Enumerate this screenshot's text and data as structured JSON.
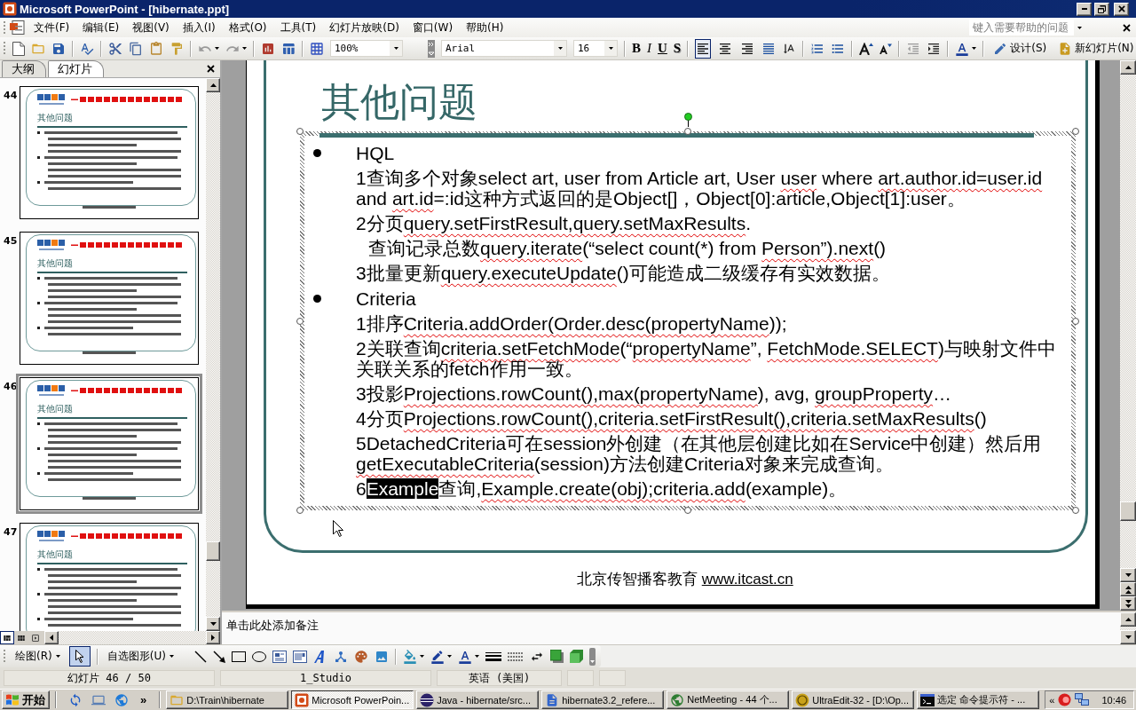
{
  "window": {
    "title": "Microsoft PowerPoint - [hibernate.ppt]"
  },
  "menu_bar": {
    "items": [
      "文件(F)",
      "编辑(E)",
      "视图(V)",
      "插入(I)",
      "格式(O)",
      "工具(T)",
      "幻灯片放映(D)",
      "窗口(W)",
      "帮助(H)"
    ],
    "help_field": {
      "placeholder": "键入需要帮助的问题"
    }
  },
  "toolbar": {
    "zoom": "100%",
    "font": "Arial",
    "font_size": "16",
    "format_buttons": [
      {
        "kind": "bold",
        "label": "B"
      },
      {
        "kind": "italic",
        "label": "I"
      },
      {
        "kind": "underline",
        "label": "U"
      },
      {
        "kind": "shadow",
        "label": "S"
      }
    ],
    "alignment": [
      {
        "kind": "left",
        "selected": true
      },
      {
        "kind": "center",
        "selected": false
      },
      {
        "kind": "right",
        "selected": false
      }
    ],
    "design_button": "设计(S)",
    "new_slide_button": "新幻灯片(N)"
  },
  "side_panel": {
    "tabs": [
      {
        "label": "大纲",
        "selected": false
      },
      {
        "label": "幻灯片",
        "selected": true
      }
    ],
    "thumbnails": [
      {
        "number": "44",
        "title": "其他问题",
        "selected": false
      },
      {
        "number": "45",
        "title": "其他问题",
        "selected": false
      },
      {
        "number": "46",
        "title": "其他问题",
        "selected": true
      },
      {
        "number": "47",
        "title": "其他问题",
        "selected": false
      }
    ]
  },
  "slide": {
    "title": "其他问题",
    "sections": [
      {
        "heading": "HQL",
        "items": [
          {
            "indented": false,
            "segments": [
              {
                "kind": "plain",
                "text": "1查询多个对象select art, user from Article art, User "
              },
              {
                "kind": "flagged",
                "text": "user"
              },
              {
                "kind": "plain",
                "text": " where "
              },
              {
                "kind": "flagged",
                "text": "art.author.id=user.id"
              },
              {
                "kind": "plain",
                "text": " and "
              },
              {
                "kind": "flagged",
                "text": "art.id"
              },
              {
                "kind": "plain",
                "text": "=:id这种方式返回的是Object[]，Object[0]:article,Object[1]:user。"
              }
            ]
          },
          {
            "indented": false,
            "segments": [
              {
                "kind": "plain",
                "text": "2分页"
              },
              {
                "kind": "flagged",
                "text": "query.setFirstResult,query.setMaxResults"
              },
              {
                "kind": "plain",
                "text": "."
              }
            ]
          },
          {
            "indented": true,
            "segments": [
              {
                "kind": "plain",
                "text": "查询记录总数"
              },
              {
                "kind": "flagged",
                "text": "query.iterate"
              },
              {
                "kind": "plain",
                "text": "(“select count(*) from "
              },
              {
                "kind": "flagged",
                "text": "Person”).next"
              },
              {
                "kind": "plain",
                "text": "()"
              }
            ]
          },
          {
            "indented": false,
            "segments": [
              {
                "kind": "plain",
                "text": "3批量更新"
              },
              {
                "kind": "flagged",
                "text": "query.executeUpdate"
              },
              {
                "kind": "plain",
                "text": "()可能造成二级缓存有实效数据。"
              }
            ]
          }
        ]
      },
      {
        "heading": "Criteria",
        "items": [
          {
            "indented": false,
            "segments": [
              {
                "kind": "plain",
                "text": "1排序"
              },
              {
                "kind": "flagged",
                "text": "Criteria.addOrder(Order.desc(propertyName"
              },
              {
                "kind": "plain",
                "text": "));"
              }
            ]
          },
          {
            "indented": false,
            "segments": [
              {
                "kind": "plain",
                "text": "2关联查询"
              },
              {
                "kind": "flagged",
                "text": "criteria.setFetchMode"
              },
              {
                "kind": "plain",
                "text": "(“"
              },
              {
                "kind": "flagged",
                "text": "propertyName"
              },
              {
                "kind": "plain",
                "text": "”, "
              },
              {
                "kind": "flagged",
                "text": "FetchMode.SELECT"
              },
              {
                "kind": "plain",
                "text": ")与映射文件中关联关系的fetch作用一致。"
              }
            ]
          },
          {
            "indented": false,
            "segments": [
              {
                "kind": "plain",
                "text": "3投影"
              },
              {
                "kind": "flagged",
                "text": "Projections.rowCount(),max(propertyName"
              },
              {
                "kind": "plain",
                "text": "), avg, "
              },
              {
                "kind": "flagged",
                "text": "groupProperty"
              },
              {
                "kind": "plain",
                "text": "…"
              }
            ]
          },
          {
            "indented": false,
            "segments": [
              {
                "kind": "plain",
                "text": "4分页"
              },
              {
                "kind": "flagged",
                "text": "Projections.rowCount(),criteria.setFirstResult(),criteria.setMaxResults"
              },
              {
                "kind": "plain",
                "text": "()"
              }
            ]
          },
          {
            "indented": false,
            "segments": [
              {
                "kind": "plain",
                "text": "5DetachedCriteria可在session外创建（在其他层创建比如在Service中创建）然后用"
              },
              {
                "kind": "flagged",
                "text": "getExecutableCriteria"
              },
              {
                "kind": "plain",
                "text": "(session)方法创建Criteria对象来完成查询。"
              }
            ]
          },
          {
            "indented": false,
            "segments": [
              {
                "kind": "plain",
                "text": "6"
              },
              {
                "kind": "selected",
                "text": "Example"
              },
              {
                "kind": "plain",
                "text": "查询,"
              },
              {
                "kind": "flagged",
                "text": "Example.create(obj);criteria.add"
              },
              {
                "kind": "plain",
                "text": "(example)。"
              }
            ]
          }
        ]
      }
    ],
    "footer": {
      "text": "北京传智播客教育 ",
      "link": "www.itcast.cn"
    }
  },
  "notes": {
    "placeholder": "单击此处添加备注"
  },
  "view_buttons": [
    {
      "kind": "normal",
      "selected": true
    },
    {
      "kind": "sorter",
      "selected": false
    },
    {
      "kind": "show",
      "selected": false
    }
  ],
  "drawing_toolbar": {
    "draw_menu": "绘图(R)",
    "select_tool": {
      "selected": true
    },
    "autoshapes_menu": "自选图形(U)"
  },
  "status_bar": [
    "幻灯片 46 / 50",
    "1_Studio",
    "英语 (美国)"
  ],
  "taskbar": {
    "start": "开始",
    "more": "»",
    "tasks": [
      {
        "kind": "folder",
        "label": "D:\\Train\\hibernate",
        "selected": false
      },
      {
        "kind": "presentation",
        "label": "Microsoft PowerPoin...",
        "selected": true
      },
      {
        "kind": "sphere",
        "label": "Java - hibernate/src...",
        "selected": false
      },
      {
        "kind": "document",
        "label": "hibernate3.2_refere...",
        "selected": false
      },
      {
        "kind": "globe",
        "label": "NetMeeting - 44 个...",
        "selected": false
      },
      {
        "kind": "emblem",
        "label": "UltraEdit-32 - [D:\\Op...",
        "selected": false
      },
      {
        "kind": "console",
        "label": "选定 命令提示符 - ...",
        "selected": false
      }
    ],
    "tray_toggle": "«",
    "clock": "10:46"
  }
}
